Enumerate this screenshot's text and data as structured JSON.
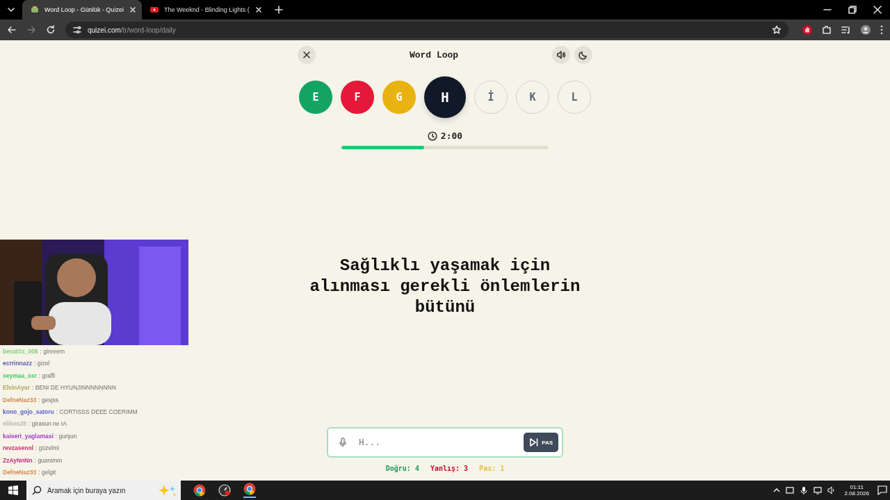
{
  "browser": {
    "tabs": [
      {
        "title": "Word Loop - Günlük - Quizei",
        "selected": true
      },
      {
        "title": "The Weeknd - Blinding Lights (",
        "selected": false
      }
    ],
    "url_host": "quizei.com",
    "url_path": "/tr/word-loop/daily"
  },
  "game": {
    "title": "Word Loop",
    "letters": [
      {
        "letter": "E",
        "kind": "correct"
      },
      {
        "letter": "F",
        "kind": "wrong"
      },
      {
        "letter": "G",
        "kind": "pass"
      },
      {
        "letter": "H",
        "kind": "current"
      },
      {
        "letter": "İ",
        "kind": "pending"
      },
      {
        "letter": "K",
        "kind": "pending"
      },
      {
        "letter": "L",
        "kind": "pending"
      }
    ],
    "timer": "2:00",
    "progress": {
      "level": 0.4
    },
    "question": "Sağlıklı yaşamak için alınması gerekli önlemlerin bütünü",
    "answer": {
      "placeholder": "H..."
    },
    "pass_button": "PAS",
    "stats": [
      {
        "kind": "correct",
        "text": "Doğru: 4"
      },
      {
        "kind": "wrong",
        "text": "Yanlış: 3"
      },
      {
        "kind": "pass",
        "text": "Pas: 1"
      }
    ]
  },
  "stream": {
    "chat": [
      {
        "user": "beratOz_008",
        "message": ": gireeem",
        "color": "#7fd07f"
      },
      {
        "user": "ecrrinnazz",
        "message": ": gizel",
        "color": "#5a5ab8"
      },
      {
        "user": "seymaa_ssr",
        "message": ": graffi",
        "color": "#3fcf5f"
      },
      {
        "user": "ElvinAyar",
        "message": ": BENI DE HYUNJINNNNNNNN",
        "color": "#b0a860"
      },
      {
        "user": "DefneNaz33",
        "message": ": gesjss",
        "color": "#d08850"
      },
      {
        "user": "kono_gojo_satoru",
        "message": ": CORTISSS DEEE COERIMM",
        "color": "#5a60c8"
      },
      {
        "user": "elikoo28",
        "message": ": girasun ne IA",
        "color": "#b8b8b8"
      },
      {
        "user": "kaiseri_yaglamasi",
        "message": ": gurşun",
        "color": "#a040c8"
      },
      {
        "user": "revzasenol",
        "message": ": güzelmi",
        "color": "#c83070"
      },
      {
        "user": "ZzAyNnNn",
        "message": ": guanimm",
        "color": "#c03080"
      },
      {
        "user": "DefneNaz33",
        "message": ": gelgit",
        "color": "#d08850"
      }
    ]
  },
  "taskbar": {
    "search_placeholder": "Aramak için buraya yazın",
    "time": "01:11",
    "date": "2.08.2026"
  }
}
